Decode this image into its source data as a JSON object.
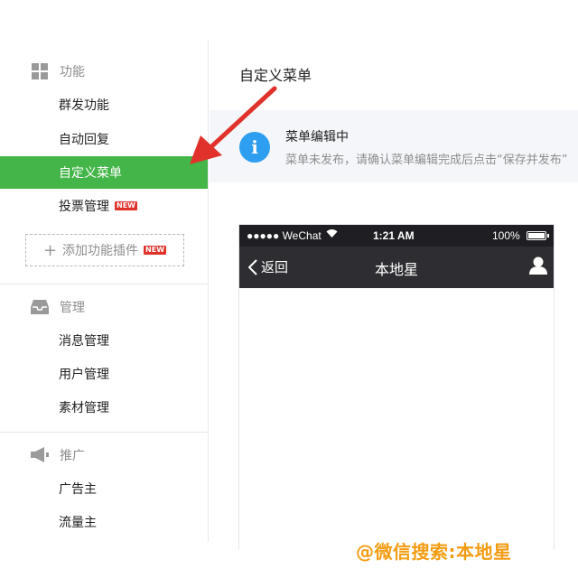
{
  "sidebar": {
    "sections": [
      {
        "title": "功能",
        "icon": "grid-icon",
        "items": [
          {
            "label": "群发功能"
          },
          {
            "label": "自动回复"
          },
          {
            "label": "自定义菜单",
            "active": true
          },
          {
            "label": "投票管理",
            "badge": "NEW"
          }
        ],
        "add_plugin": {
          "label": "添加功能插件",
          "badge": "NEW"
        }
      },
      {
        "title": "管理",
        "icon": "inbox-icon",
        "items": [
          {
            "label": "消息管理"
          },
          {
            "label": "用户管理"
          },
          {
            "label": "素材管理"
          }
        ]
      },
      {
        "title": "推广",
        "icon": "megaphone-icon",
        "items": [
          {
            "label": "广告主"
          },
          {
            "label": "流量主"
          }
        ]
      }
    ]
  },
  "main": {
    "title": "自定义菜单",
    "notice": {
      "title": "菜单编辑中",
      "desc": "菜单未发布，请确认菜单编辑完成后点击“保存并发布”"
    },
    "phone": {
      "signal": "●●●●● WeChat",
      "time": "1:21 AM",
      "battery": "100%",
      "battery_level": 1.0,
      "back_label": "返回",
      "nav_title": "本地星"
    }
  },
  "watermark": "@微信搜索:本地星",
  "colors": {
    "accent": "#44b549",
    "info": "#2d9ef0",
    "arrow": "#e0322b",
    "watermark": "#f39c12"
  }
}
